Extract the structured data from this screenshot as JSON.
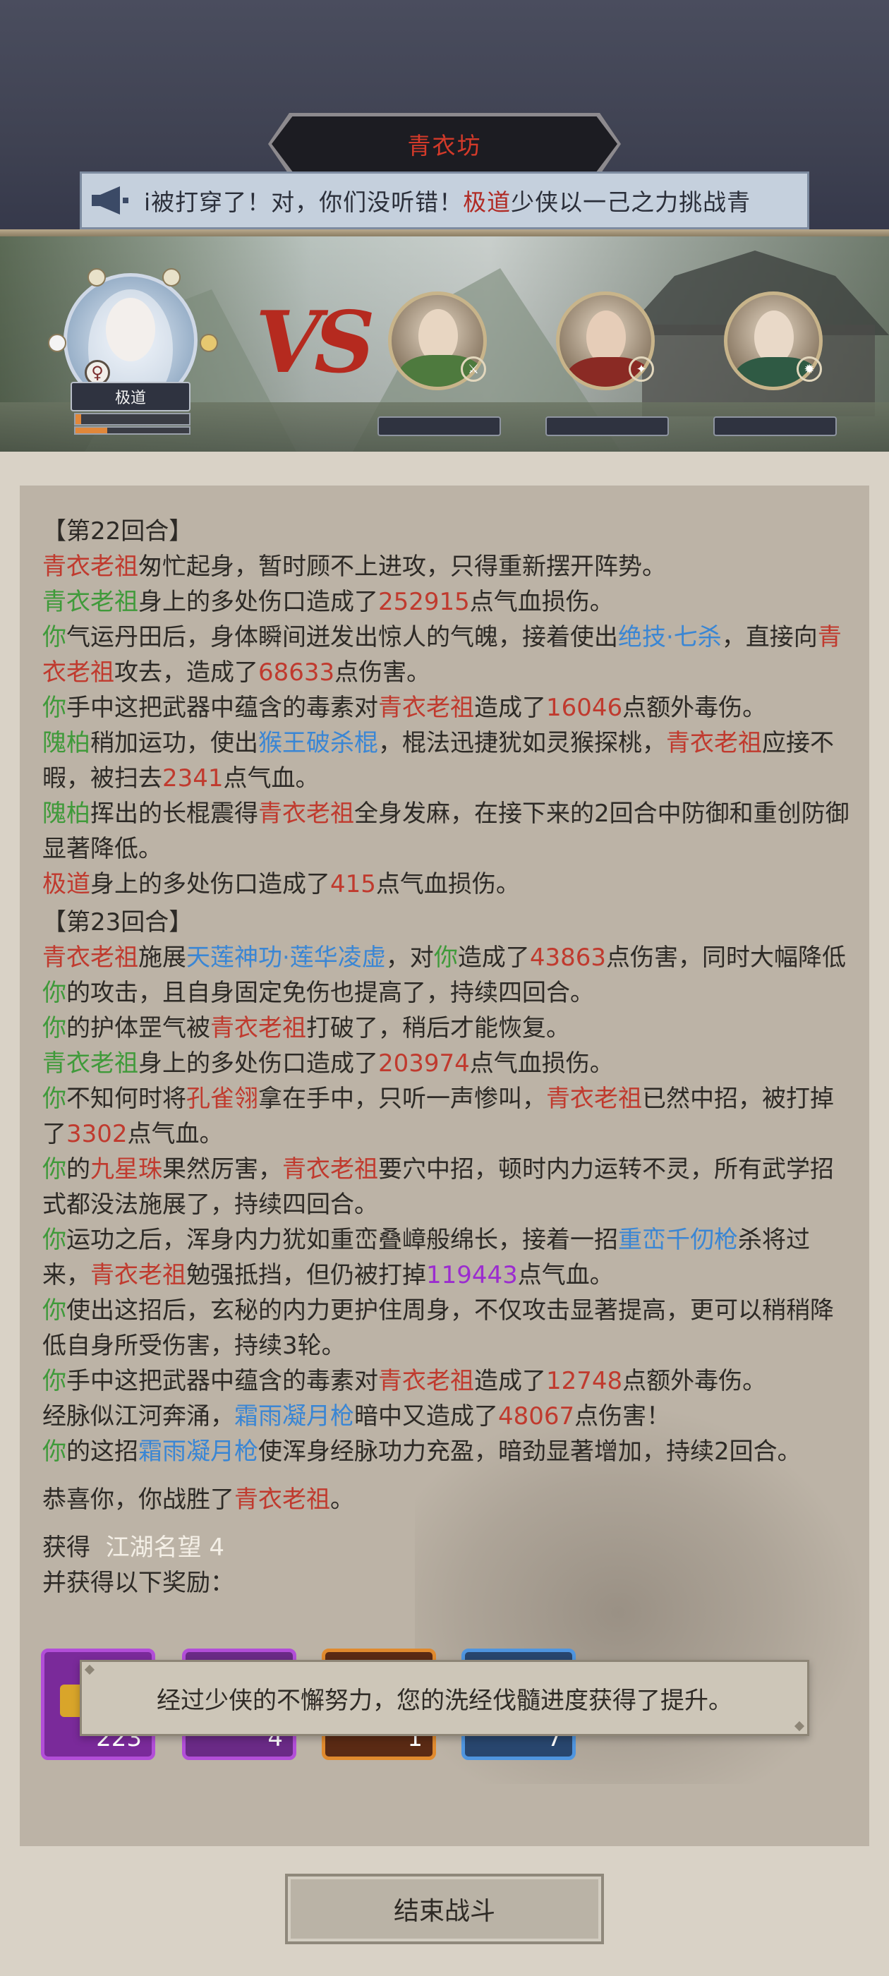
{
  "header": {
    "title": "青衣坊"
  },
  "marquee": {
    "icon": "megaphone-icon",
    "text_prefix": "i被打穿了！对，你们没听错！",
    "text_highlight": "极道",
    "text_suffix": "少侠以一己之力挑战青"
  },
  "battle": {
    "player": {
      "name": "极道",
      "gender_symbol": "♀",
      "hp_fraction": 0.05,
      "mp_fraction": 0.28
    },
    "vs_label": "VS",
    "enemies": [
      {
        "badge_icon": "sword-icon",
        "badge_color": "#3f9a3a"
      },
      {
        "badge_icon": "fan-icon",
        "badge_color": "#3a86d4"
      },
      {
        "badge_icon": "flame-icon",
        "badge_color": "#e0873a"
      }
    ]
  },
  "log": {
    "round22": "【第22回合】",
    "l1": {
      "a": "青衣老祖",
      "b": "匆忙起身，暂时顾不上进攻，只得重新摆开阵势。"
    },
    "l2": {
      "a": "青衣老祖",
      "b": "身上的多处伤口造成了",
      "c": "252915",
      "d": "点气血损伤。"
    },
    "l3": {
      "a": "你",
      "b": "气运丹田后，身体瞬间迸发出惊人的气魄，接着使出",
      "c": "绝技·七杀",
      "d": "，直接向",
      "e": "青衣老祖",
      "f": "攻去，造成了",
      "g": "68633",
      "h": "点伤害。"
    },
    "l4": {
      "a": "你",
      "b": "手中这把武器中蕴含的毒素对",
      "c": "青衣老祖",
      "d": "造成了",
      "e": "16046",
      "f": "点额外毒伤。"
    },
    "l5": {
      "a": "隗柏",
      "b": "稍加运功，使出",
      "c": "猴王破杀棍",
      "d": "，棍法迅捷犹如灵猴探桃，",
      "e": "青衣老祖",
      "f": "应接不暇，被扫去",
      "g": "2341",
      "h": "点气血。"
    },
    "l6": {
      "a": "隗柏",
      "b": "挥出的长棍震得",
      "c": "青衣老祖",
      "d": "全身发麻，在接下来的2回合中防御和重创防御显著降低。"
    },
    "l7": {
      "a": "极道",
      "b": "身上的多处伤口造成了",
      "c": "415",
      "d": "点气血损伤。"
    },
    "round23": "【第23回合】",
    "m1": {
      "a": "青衣老祖",
      "b": "施展",
      "c": "天莲神功·莲华凌虚",
      "d": "，对",
      "e": "你",
      "f": "造成了",
      "g": "43863",
      "h": "点伤害，同时大幅降低",
      "i": "你",
      "j": "的攻击，且自身固定免伤也提高了，持续四回合。"
    },
    "m2": {
      "a": "你",
      "b": "的护体罡气被",
      "c": "青衣老祖",
      "d": "打破了，稍后才能恢复。"
    },
    "m3": {
      "a": "青衣老祖",
      "b": "身上的多处伤口造成了",
      "c": "203974",
      "d": "点气血损伤。"
    },
    "m4": {
      "a": "你",
      "b": "不知何时将",
      "c": "孔雀翎",
      "d": "拿在手中，只听一声惨叫，",
      "e": "青衣老祖",
      "f": "已然中招，被打掉了",
      "g": "3302",
      "h": "点气血。"
    },
    "m5": {
      "a": "你",
      "b": "的",
      "c": "九星珠",
      "d": "果然厉害，",
      "e": "青衣老祖",
      "f": "要穴中招，顿时内力运转不灵，所有武学招式都没法施展了，持续四回合。"
    },
    "m6": {
      "a": "你",
      "b": "运功之后，浑身内力犹如重峦叠嶂般绵长，接着一招",
      "c": "重峦千仞枪",
      "d": "杀将过来，",
      "e": "青衣老祖",
      "f": "勉强抵挡，但仍被打掉",
      "g": "119443",
      "h": "点气血。"
    },
    "m7": {
      "a": "你",
      "b": "使出这招后，玄秘的内力更护住周身，不仅攻击显著提高，更可以稍稍降低自身所受伤害，持续3轮。"
    },
    "m8": {
      "a": "你",
      "b": "手中这把武器中蕴含的毒素对",
      "c": "青衣老祖",
      "d": "造成了",
      "e": "12748",
      "f": "点额外毒伤。"
    },
    "m9": {
      "a": "经脉似江河奔涌，",
      "b": "霜雨凝月枪",
      "c": "暗中又造成了",
      "d": "48067",
      "e": "点伤害！"
    },
    "m10": {
      "a": "你",
      "b": "的这招",
      "c": "霜雨凝月枪",
      "d": "使浑身经脉功力充盈，暗劲显著增加，持续2回合。"
    },
    "victory": {
      "a": "恭喜你，你战胜了",
      "b": "青衣老祖",
      "c": "。"
    },
    "gain": {
      "a": "获得",
      "b": "江湖名望 4"
    },
    "rewards_label": "并获得以下奖励："
  },
  "rewards": [
    {
      "count": "223",
      "color": "#7a2a9a",
      "border": "#b24ed8"
    },
    {
      "count": "4",
      "color": "#6a2a86",
      "border": "#b24ed8"
    },
    {
      "count": "1",
      "color": "#5a2a14",
      "border": "#e08a2e"
    },
    {
      "count": "7",
      "color": "#28466e",
      "border": "#4f95df"
    }
  ],
  "toast": "经过少侠的不懈努力，您的洗经伐髓进度获得了提升。",
  "end_button": "结束战斗"
}
